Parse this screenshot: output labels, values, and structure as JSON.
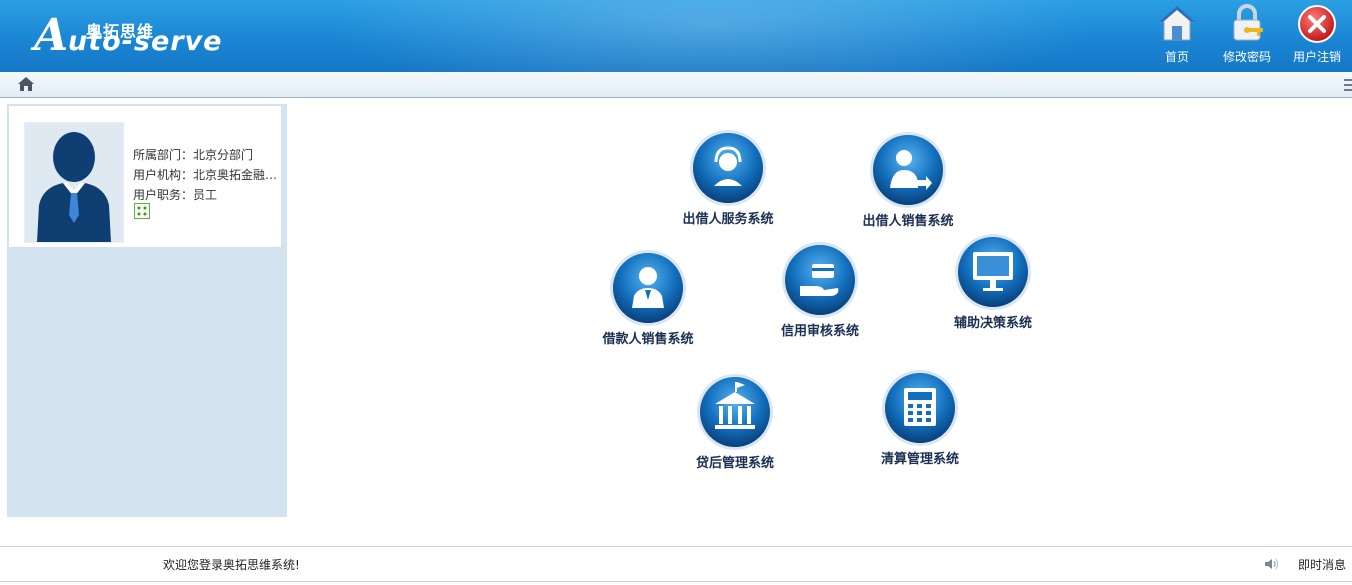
{
  "header": {
    "logo_cn": "奥拓思维",
    "logo_en": "uto-serve",
    "logo_initial": "A",
    "buttons": [
      {
        "label": "首页",
        "icon": "home-icon"
      },
      {
        "label": "修改密码",
        "icon": "lock-key-icon"
      },
      {
        "label": "用户注销",
        "icon": "close-icon"
      }
    ]
  },
  "user": {
    "department": "所属部门：北京分部门",
    "organization": "用户机构：北京奥拓金融…",
    "position": "用户职务：员工"
  },
  "systems": [
    {
      "name": "出借人服务系统",
      "icon": "headset-agent-icon"
    },
    {
      "name": "出借人销售系统",
      "icon": "person-arrow-icon"
    },
    {
      "name": "借款人销售系统",
      "icon": "person-badge-icon"
    },
    {
      "name": "信用审核系统",
      "icon": "card-hand-icon"
    },
    {
      "name": "辅助决策系统",
      "icon": "monitor-icon"
    },
    {
      "name": "贷后管理系统",
      "icon": "bank-building-icon"
    },
    {
      "name": "清算管理系统",
      "icon": "calculator-icon"
    }
  ],
  "footer": {
    "welcome": "欢迎您登录奥拓思维系统!",
    "instant_message": "即时消息"
  },
  "colors": {
    "header_blue": "#1a86d4",
    "panel_blue": "#d3e4f0",
    "system_label": "#1b2f52"
  }
}
